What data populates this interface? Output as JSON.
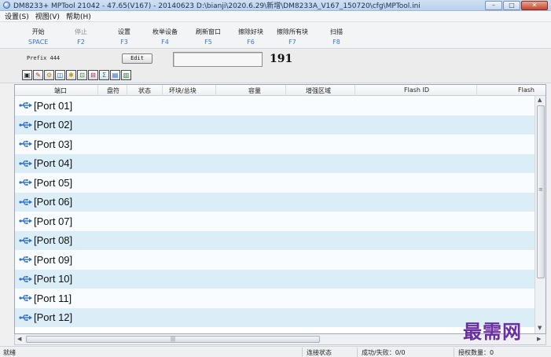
{
  "window": {
    "title": "DM8233+ MPTool 21042 - 47.65(V167) - 20140623  D:\\bianji\\2020.6.29\\新增\\DM8233A_V167_150720\\cfg\\MPTool.ini",
    "minimize": "–",
    "maximize": "□",
    "close": "✕"
  },
  "menu": [
    "设置(S)",
    "视图(V)",
    "帮助(H)"
  ],
  "toolbar": [
    {
      "label": "开始",
      "key": "SPACE",
      "disabled": false
    },
    {
      "label": "停止",
      "key": "F2",
      "disabled": true
    },
    {
      "label": "设置",
      "key": "F3",
      "disabled": false
    },
    {
      "label": "枚举设备",
      "key": "F4",
      "disabled": false
    },
    {
      "label": "刷新窗口",
      "key": "F5",
      "disabled": false
    },
    {
      "label": "擦除好块",
      "key": "F6",
      "disabled": false
    },
    {
      "label": "擦除所有块",
      "key": "F7",
      "disabled": false
    },
    {
      "label": "扫描",
      "key": "F8",
      "disabled": false
    }
  ],
  "prefix": {
    "label": "Prefix 444",
    "edit_label": "Edit",
    "count": "191"
  },
  "iconbar": [
    "▣",
    "✎",
    "⚙",
    "◫",
    "✱",
    "⊡",
    "⊟",
    "Σ",
    "▤",
    "▥"
  ],
  "columns": [
    "端口",
    "盘符",
    "状态",
    "坏块/总块",
    "容量",
    "增强区域",
    "Flash ID",
    "Flash"
  ],
  "ports": [
    "[Port 01]",
    "[Port 02]",
    "[Port 03]",
    "[Port 04]",
    "[Port 05]",
    "[Port 06]",
    "[Port 07]",
    "[Port 08]",
    "[Port 09]",
    "[Port 10]",
    "[Port 11]",
    "[Port 12]"
  ],
  "scroll": {
    "up": "▲",
    "down": "▼",
    "left": "◀",
    "right": "▶",
    "grip": "|||",
    "grip_v": "≡"
  },
  "status": {
    "ready": "就绪",
    "conn": "连接状态",
    "success": "成功/失败：0/0",
    "license": "授权数量：0"
  },
  "watermark": "最需网",
  "colors": {
    "row_alt": "#dbeef7",
    "key_blue": "#3a78c9",
    "usb_blue": "#2f6fd1",
    "watermark": "#6b2ea0"
  }
}
